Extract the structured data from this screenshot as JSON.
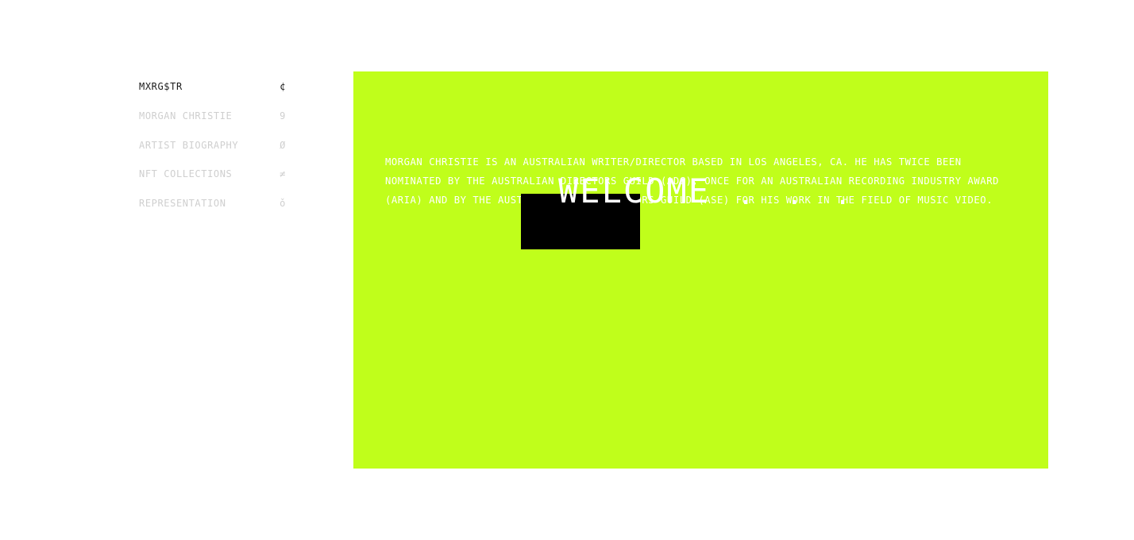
{
  "sidebar": {
    "items": [
      {
        "label": "MXRG$TR",
        "glyph": "¢",
        "active": true
      },
      {
        "label": "MORGAN CHRISTIE",
        "glyph": "9",
        "active": false
      },
      {
        "label": "ARTIST BIOGRAPHY",
        "glyph": "Ø",
        "active": false
      },
      {
        "label": "NFT COLLECTIONS",
        "glyph": "≠",
        "active": false
      },
      {
        "label": "REPRESENTATION",
        "glyph": "ǒ",
        "active": false
      }
    ]
  },
  "main": {
    "bio": "MORGAN CHRISTIE IS AN AUSTRALIAN WRITER/DIRECTOR BASED IN LOS ANGELES, CA. HE HAS TWICE BEEN NOMINATED BY THE AUSTRALIAN DIRECTORS GUILD (ADG), ONCE FOR AN AUSTRALIAN RECORDING INDUSTRY AWARD (ARIA) AND BY THE AUSTRALIAN SCREEN EDITORS GUILD (ASE) FOR HIS WORK IN THE FIELD OF MUSIC VIDEO.",
    "welcome": "WELCOME",
    "dots": ". . ."
  },
  "colors": {
    "accent": "#c0fe1b",
    "nav_active": "#1b1b1b",
    "nav_inactive": "#cfcfcf",
    "overlay_box": "#000000"
  }
}
